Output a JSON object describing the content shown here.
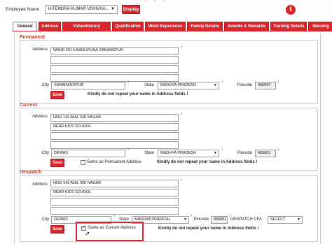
{
  "header": {
    "employee_label": "Employee Name",
    "employee_value": "HITENDRA KUMAR VISHVKA...",
    "display_button": "Display",
    "info_icon": "i"
  },
  "tabs": [
    {
      "label": "General",
      "active": true
    },
    {
      "label": "Address",
      "active": false
    },
    {
      "label": "VirbacHistory",
      "active": false
    },
    {
      "label": "Qualification",
      "active": false
    },
    {
      "label": "Work Experience",
      "active": false
    },
    {
      "label": "Family Details",
      "active": false
    },
    {
      "label": "Awards & Rewards",
      "active": false
    },
    {
      "label": "Training Details",
      "active": false
    },
    {
      "label": "Warning",
      "active": false
    }
  ],
  "permanent": {
    "title": "Permanent",
    "address_label": "Address",
    "address_lines": [
      "WARD NO 6-BADLIPURA SARANGPUR",
      "",
      "",
      ""
    ],
    "city_label": "City",
    "city": "SARARANGPUR",
    "state_label": "State",
    "state": "MADHYA PRADESH",
    "pincode_label": "Pincode",
    "pincode": "465697",
    "save": "Save",
    "warning": "Kindly do not repeat your name in Address fields !"
  },
  "current": {
    "title": "Current",
    "address_label": "Address",
    "address_lines": [
      "HNO-142 ANIL SRI NAGAR",
      "NEAR KIDS SCHOOL",
      "",
      ""
    ],
    "city_label": "City",
    "city": "DEWAS",
    "state_label": "State",
    "state": "MADHYA PRADESH",
    "pincode_label": "Pincode",
    "pincode": "455001",
    "save": "Save",
    "same_as_label": "Same as Permanent Address",
    "same_as_checked": false,
    "warning": "Kindly do not repeat your name in Address fields !"
  },
  "despatch": {
    "title": "Despatch",
    "address_label": "Address",
    "address_lines": [
      "HNO-142 ANIL SRI NAGAR",
      "NEAR KIDS SCHOOL",
      "",
      ""
    ],
    "city_label": "City",
    "city": "DEWAS",
    "state_label": "State",
    "state": "MADHYA PRADESH",
    "pincode_label": "Pincode",
    "pincode": "455001",
    "cfa_label": "DESPATCH CFA",
    "cfa": "SELECT",
    "save": "Save",
    "same_as_label": "Same as Current Address",
    "same_as_checked": true,
    "warning": "Kindly do not repeat your name in Address fields !"
  },
  "colors": {
    "accent": "#d9252c",
    "highlight": "#d9252c"
  }
}
